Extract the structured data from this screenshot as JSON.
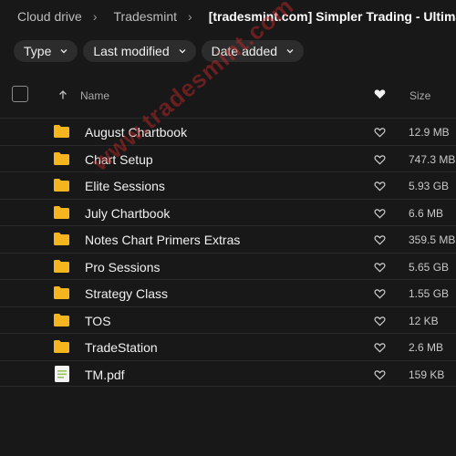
{
  "breadcrumb": {
    "items": [
      "Cloud drive",
      "Tradesmint",
      "[tradesmint.com] Simpler Trading - Ultimate I"
    ]
  },
  "filters": [
    "Type",
    "Last modified",
    "Date added"
  ],
  "table": {
    "columns": {
      "name": "Name",
      "size": "Size"
    },
    "rows": [
      {
        "name": "August Chartbook",
        "size": "12.9 MB",
        "icon": "folder-icon"
      },
      {
        "name": "Chart Setup",
        "size": "747.3 MB",
        "icon": "folder-icon"
      },
      {
        "name": "Elite Sessions",
        "size": "5.93 GB",
        "icon": "folder-icon"
      },
      {
        "name": "July Chartbook",
        "size": "6.6 MB",
        "icon": "folder-icon"
      },
      {
        "name": "Notes Chart Primers Extras",
        "size": "359.5 MB",
        "icon": "folder-icon"
      },
      {
        "name": "Pro Sessions",
        "size": "5.65 GB",
        "icon": "folder-icon"
      },
      {
        "name": "Strategy Class",
        "size": "1.55 GB",
        "icon": "folder-icon"
      },
      {
        "name": "TOS",
        "size": "12 KB",
        "icon": "folder-icon"
      },
      {
        "name": "TradeStation",
        "size": "2.6 MB",
        "icon": "folder-icon"
      },
      {
        "name": "TM.pdf",
        "size": "159 KB",
        "icon": "pdf-file-icon"
      }
    ]
  },
  "watermark": "www.tradesmint.com",
  "colors": {
    "background": "#181818",
    "folder": "#f5b51e",
    "watermark": "#c82828"
  }
}
